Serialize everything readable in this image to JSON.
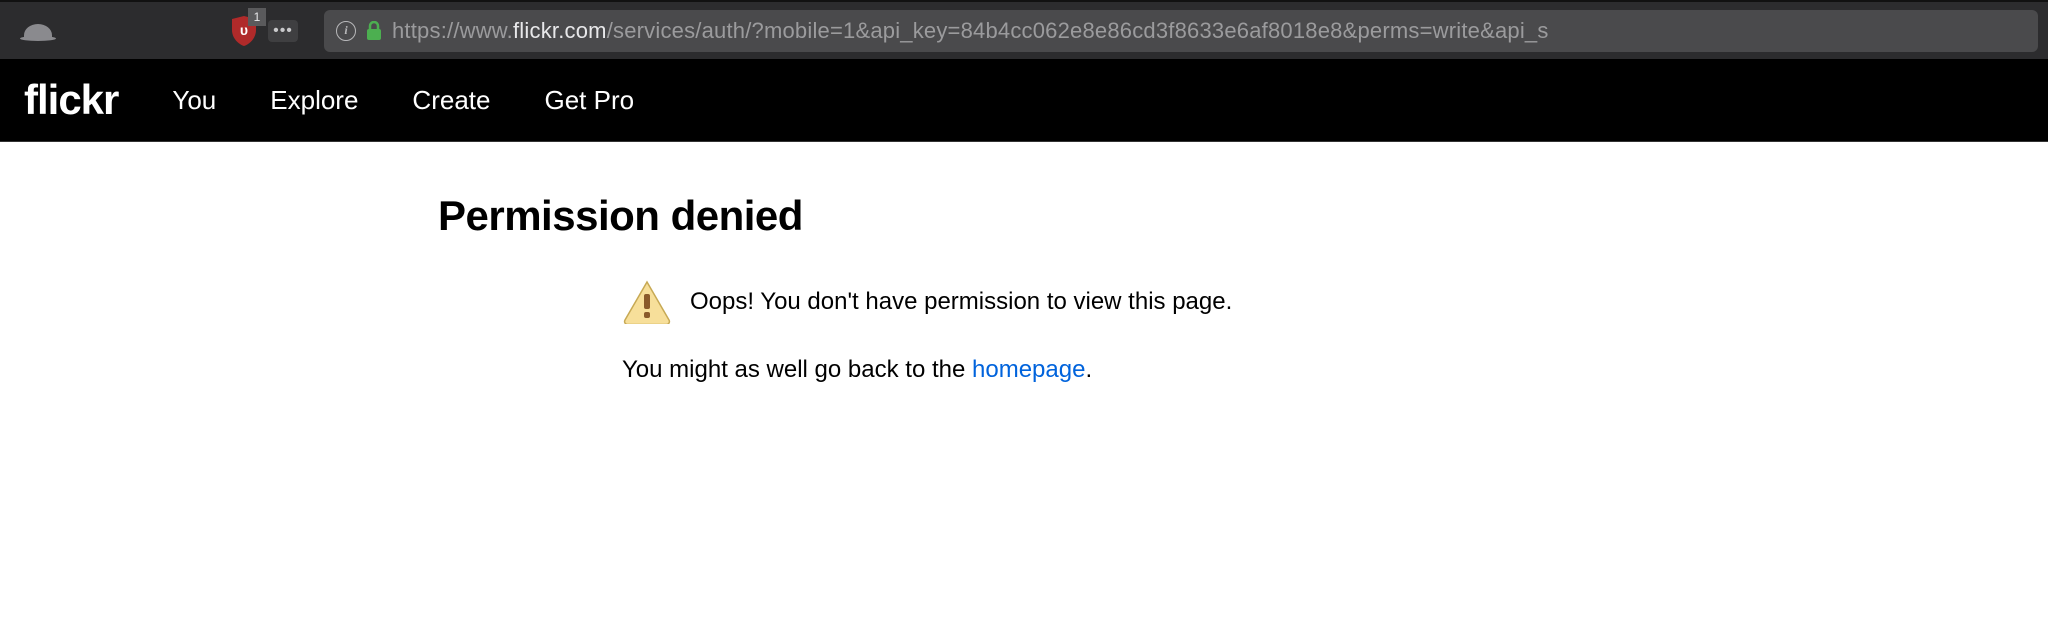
{
  "browser": {
    "ublock_badge": "1",
    "url": {
      "protocol": "https://www.",
      "host": "flickr.com",
      "path": "/services/auth/?mobile=1&api_key=84b4cc062e8e86cd3f8633e6af8018e8&perms=write&api_s"
    }
  },
  "nav": {
    "logo": "flickr",
    "links": {
      "you": "You",
      "explore": "Explore",
      "create": "Create",
      "get_pro": "Get Pro"
    }
  },
  "page": {
    "title": "Permission denied",
    "oops": "Oops! You don't have permission to view this page.",
    "sub_prefix": "You might as well go back to the ",
    "homepage_link": "homepage",
    "sub_suffix": "."
  }
}
